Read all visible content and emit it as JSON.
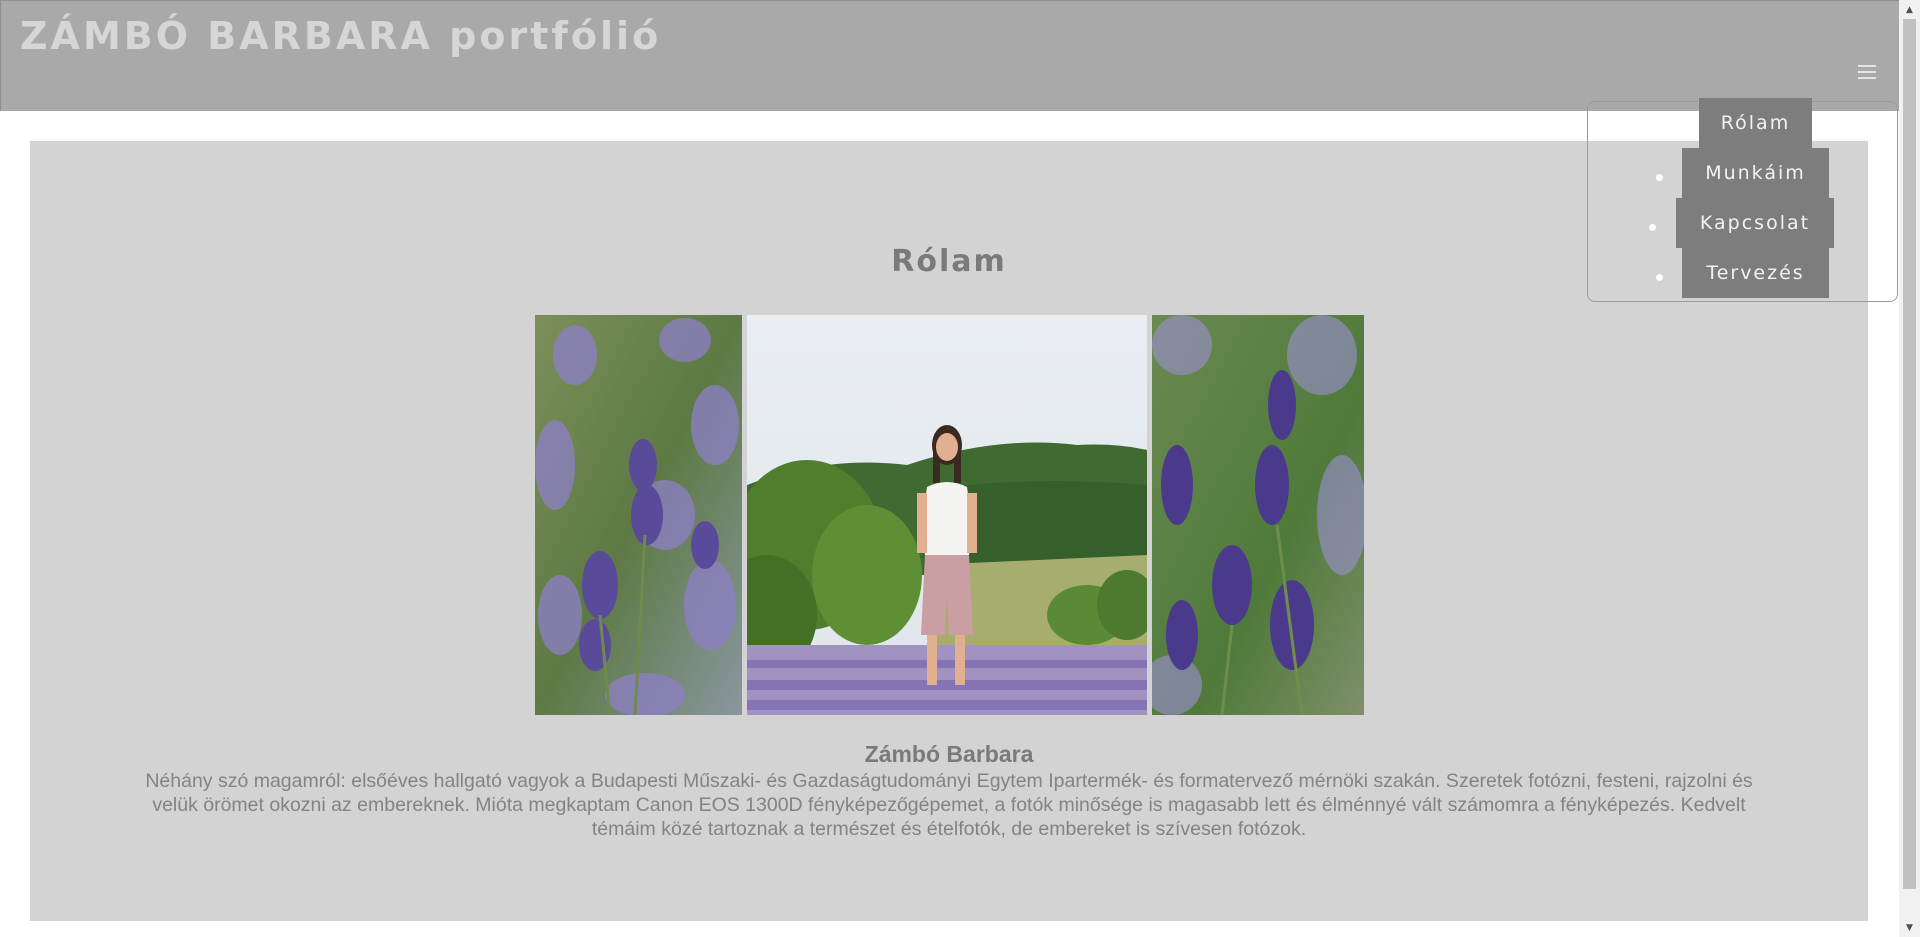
{
  "header": {
    "site_title": "ZÁMBÓ BARBARA portfólió",
    "menu_icon": "hamburger-menu-icon"
  },
  "main": {
    "heading": "Rólam",
    "photos": [
      {
        "subject": "lavender flowers close-up"
      },
      {
        "subject": "girl standing in lavender field with green hills"
      },
      {
        "subject": "lavender flowers close-up"
      }
    ],
    "author_name": "Zámbó Barbara",
    "bio": "Néhány szó magamról: elsőéves hallgató vagyok a Budapesti Műszaki- és Gazdaságtudományi Egytem Ipartermék- és formatervező mérnöki szakán. Szeretek fotózni, festeni, rajzolni és velük örömet okozni az embereknek. Mióta megkaptam Canon EOS 1300D fényképezőgépemet, a fotók minősége is magasabb lett és élménnyé vált számomra a fényképezés. Kedvelt témáim közé tartoznak a természet és ételfotók, de embereket is szívesen fotózok."
  },
  "nav": {
    "items": [
      {
        "label": "Rólam"
      },
      {
        "label": "Munkáim"
      },
      {
        "label": "Kapcsolat"
      },
      {
        "label": "Tervezés"
      }
    ]
  },
  "colors": {
    "header_bg": "#a9a9a9",
    "content_bg": "#d3d3d3",
    "nav_item_bg": "#7d7d7d",
    "heading_text": "#7a7a7a"
  }
}
